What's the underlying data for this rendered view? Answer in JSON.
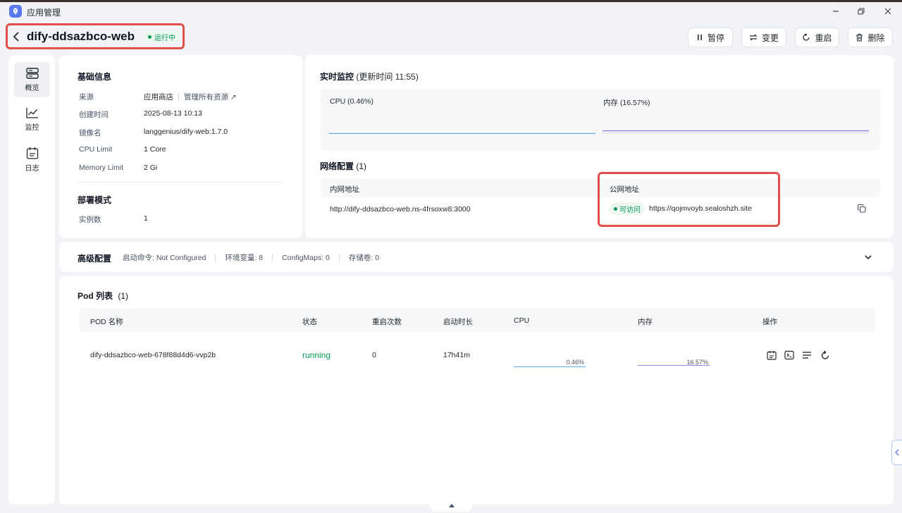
{
  "window": {
    "title": "应用管理"
  },
  "header": {
    "app_name": "dify-ddsazbco-web",
    "status": "运行中",
    "actions": {
      "pause": "暂停",
      "change": "变更",
      "restart": "重启",
      "delete": "删除"
    }
  },
  "sidebar": {
    "items": [
      {
        "label": "概览",
        "icon": "server-icon"
      },
      {
        "label": "监控",
        "icon": "chart-line-icon"
      },
      {
        "label": "日志",
        "icon": "calendar-log-icon"
      }
    ]
  },
  "basic": {
    "title": "基础信息",
    "rows": [
      {
        "label": "来源",
        "value": "应用商店",
        "link": "管理所有资源"
      },
      {
        "label": "创建时间",
        "value": "2025-08-13 10:13"
      },
      {
        "label": "镜像名",
        "value": "langgenius/dify-web:1.7.0"
      },
      {
        "label": "CPU Limit",
        "value": "1 Core"
      },
      {
        "label": "Memory Limit",
        "value": "2 Gi"
      }
    ],
    "deploy_title": "部署模式",
    "deploy_rows": [
      {
        "label": "实例数",
        "value": "1"
      }
    ]
  },
  "monitor": {
    "title": "实时监控",
    "updated": "(更新时间  11:55)",
    "cpu_label": "CPU  (0.46%)",
    "mem_label": "内存  (16.57%)",
    "cpu_percent": 0.46,
    "mem_percent": 16.57
  },
  "network": {
    "title": "网络配置",
    "count": "(1)",
    "col_internal": "内网地址",
    "col_public": "公网地址",
    "internal": "http://dify-ddsazbco-web.ns-4frsoxw8:3000",
    "public_status": "可访问",
    "public": "https://qojmvoyb.sealoshzh.site"
  },
  "advanced": {
    "title": "高级配置",
    "items": [
      "启动命令: Not Configured",
      "环境变量: 8",
      "ConfigMaps: 0",
      "存储卷: 0"
    ]
  },
  "pods": {
    "title": "Pod 列表",
    "count": "(1)",
    "columns": [
      "POD 名称",
      "状态",
      "重启次数",
      "启动时长",
      "CPU",
      "内存",
      "操作"
    ],
    "rows": [
      {
        "name": "dify-ddsazbco-web-678f88d4d6-vvp2b",
        "status": "running",
        "restarts": "0",
        "uptime": "17h41m",
        "cpu": "0.46%",
        "mem": "16.57%"
      }
    ]
  },
  "colors": {
    "accent": "#5a78f0",
    "running": "#039855",
    "highlight": "#e0504a",
    "cpu_line": "#6aa6e8",
    "mem_line": "#8f83e8"
  }
}
